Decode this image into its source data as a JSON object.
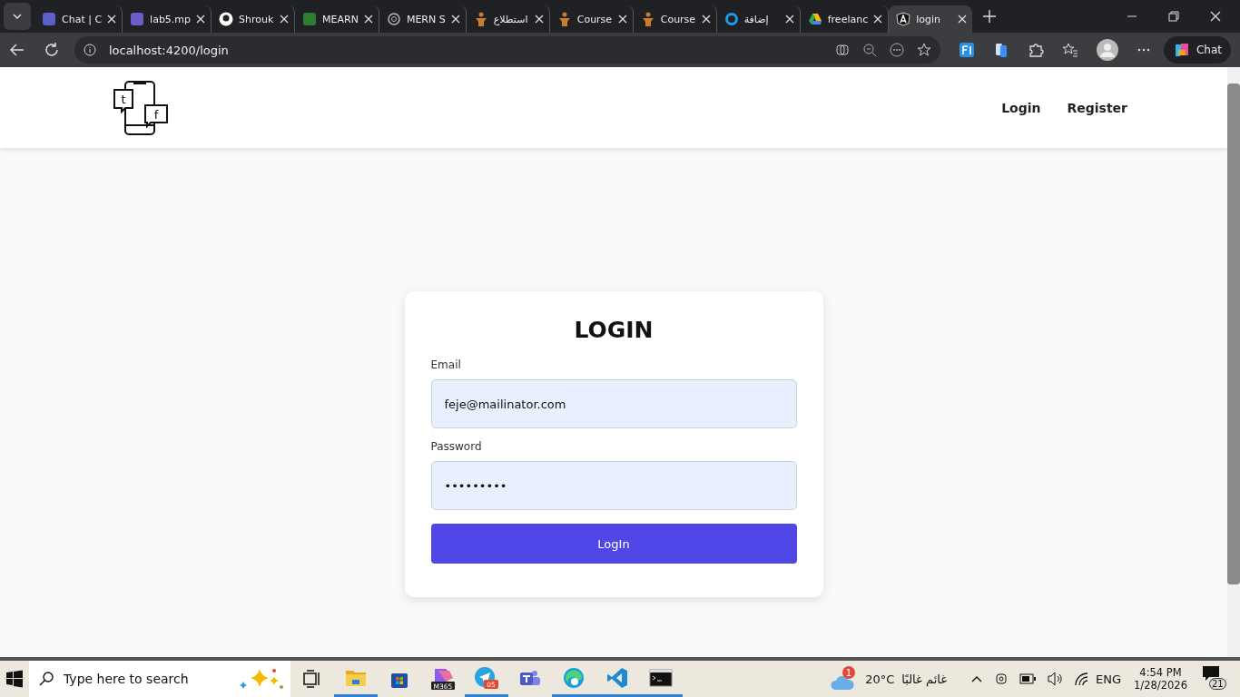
{
  "browser": {
    "tabs": [
      {
        "title": "Chat | C",
        "kind": "teams",
        "selected": false
      },
      {
        "title": "lab5.mp",
        "kind": "video",
        "selected": false
      },
      {
        "title": "Shrouk",
        "kind": "github",
        "selected": false
      },
      {
        "title": "MEARN",
        "kind": "sheet",
        "selected": false
      },
      {
        "title": "MERN S",
        "kind": "swirl",
        "selected": false
      },
      {
        "title": "استطلاع",
        "kind": "figure",
        "selected": false
      },
      {
        "title": "Course",
        "kind": "figure",
        "selected": false
      },
      {
        "title": "Course",
        "kind": "figure",
        "selected": false
      },
      {
        "title": "إضافة",
        "kind": "ring",
        "selected": false
      },
      {
        "title": "freelanc",
        "kind": "drive",
        "selected": false
      },
      {
        "title": "login",
        "kind": "angular",
        "selected": true
      }
    ],
    "address": "localhost:4200/login",
    "chat_button": "Chat"
  },
  "page": {
    "logo": {
      "letters": [
        "t",
        "f"
      ]
    },
    "nav": [
      {
        "label": "Login"
      },
      {
        "label": "Register"
      }
    ],
    "form": {
      "title": "LOGIN",
      "fields": [
        {
          "label": "Email",
          "value": "feje@mailinator.com"
        },
        {
          "label": "Password",
          "value": "•••••••••"
        }
      ],
      "submit": "LogIn"
    }
  },
  "taskbar": {
    "search_placeholder": "Type here to search",
    "apps": [
      {
        "kind": "taskview",
        "active": false
      },
      {
        "kind": "explorer",
        "active": true
      },
      {
        "kind": "store",
        "active": false
      },
      {
        "kind": "m365",
        "active": false,
        "text": "M365"
      },
      {
        "kind": "telegram",
        "active": true,
        "badge": "05"
      },
      {
        "kind": "teams",
        "active": false
      },
      {
        "kind": "edge",
        "active": true
      },
      {
        "kind": "vscode",
        "active": true
      },
      {
        "kind": "terminal",
        "active": true
      }
    ],
    "weather": {
      "badge": "1",
      "temp": "20°C",
      "condition": "غائم غالبًا"
    },
    "language": "ENG",
    "time": "4:54 PM",
    "date": "1/28/2026",
    "notifications": "21"
  }
}
